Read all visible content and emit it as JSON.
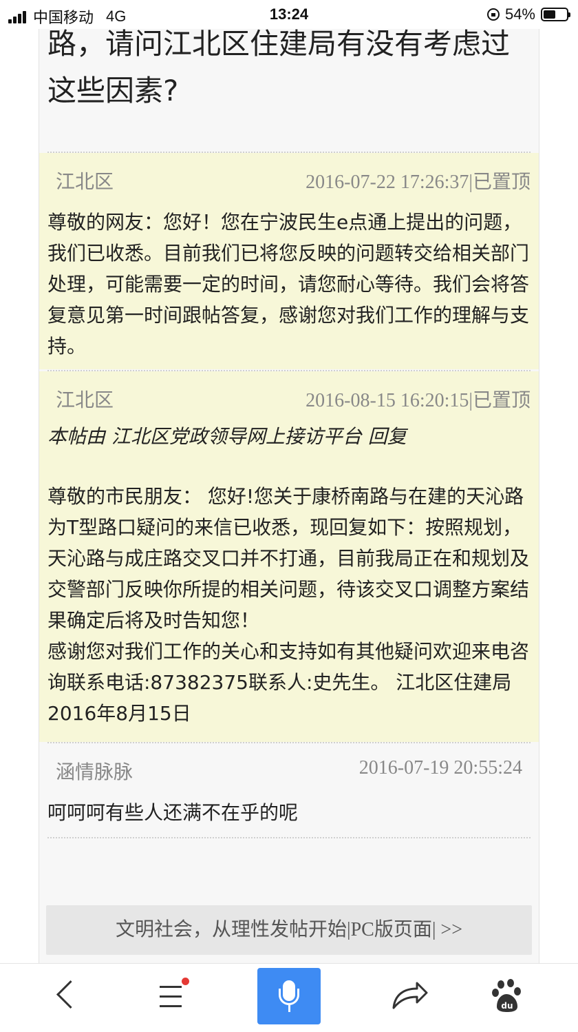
{
  "status_bar": {
    "carrier": "中国移动",
    "network": "4G",
    "time": "13:24",
    "battery": "54%",
    "battery_level": 0.54
  },
  "question": {
    "tail_text": "路，请问江北区住建局有没有考虑过这些因素?"
  },
  "replies": [
    {
      "author": "江北区",
      "time": "2016-07-22 17:26:37|已置顶",
      "body": "尊敬的网友：您好！您在宁波民生e点通上提出的问题，我们已收悉。目前我们已将您反映的问题转交给相关部门处理，可能需要一定的时间，请您耐心等待。我们会将答复意见第一时间跟帖答复，感谢您对我们工作的理解与支持。"
    },
    {
      "author": "江北区",
      "time": "2016-08-15 16:20:15|已置顶",
      "note": "本帖由 江北区党政领导网上接访平台 回复",
      "body": "尊敬的市民朋友： 您好!您关于康桥南路与在建的天沁路为T型路口疑问的来信已收悉，现回复如下：按照规划，天沁路与成庄路交叉口并不打通，目前我局正在和规划及交警部门反映你所提的相关问题，待该交叉口调整方案结果确定后将及时告知您！\n感谢您对我们工作的关心和支持如有其他疑问欢迎来电咨询联系电话:87382375联系人:史先生。 江北区住建局 2016年8月15日"
    },
    {
      "author": "涵情脉脉",
      "time": "2016-07-19 20:55:24",
      "body": "呵呵呵有些人还满不在乎的呢"
    }
  ],
  "footer": {
    "text": "文明社会，从理性发帖开始|PC版页面| >>"
  },
  "bottom_nav": {
    "items": [
      "back-icon",
      "menu-icon",
      "microphone-icon",
      "share-icon",
      "baidu-paw-icon"
    ],
    "accent": "#3e8bf3",
    "badge_color": "#e53935"
  },
  "colors": {
    "official_reply_bg": "#f7f7d8",
    "column_bg": "#f7f7f7",
    "meta_text": "#888888"
  }
}
